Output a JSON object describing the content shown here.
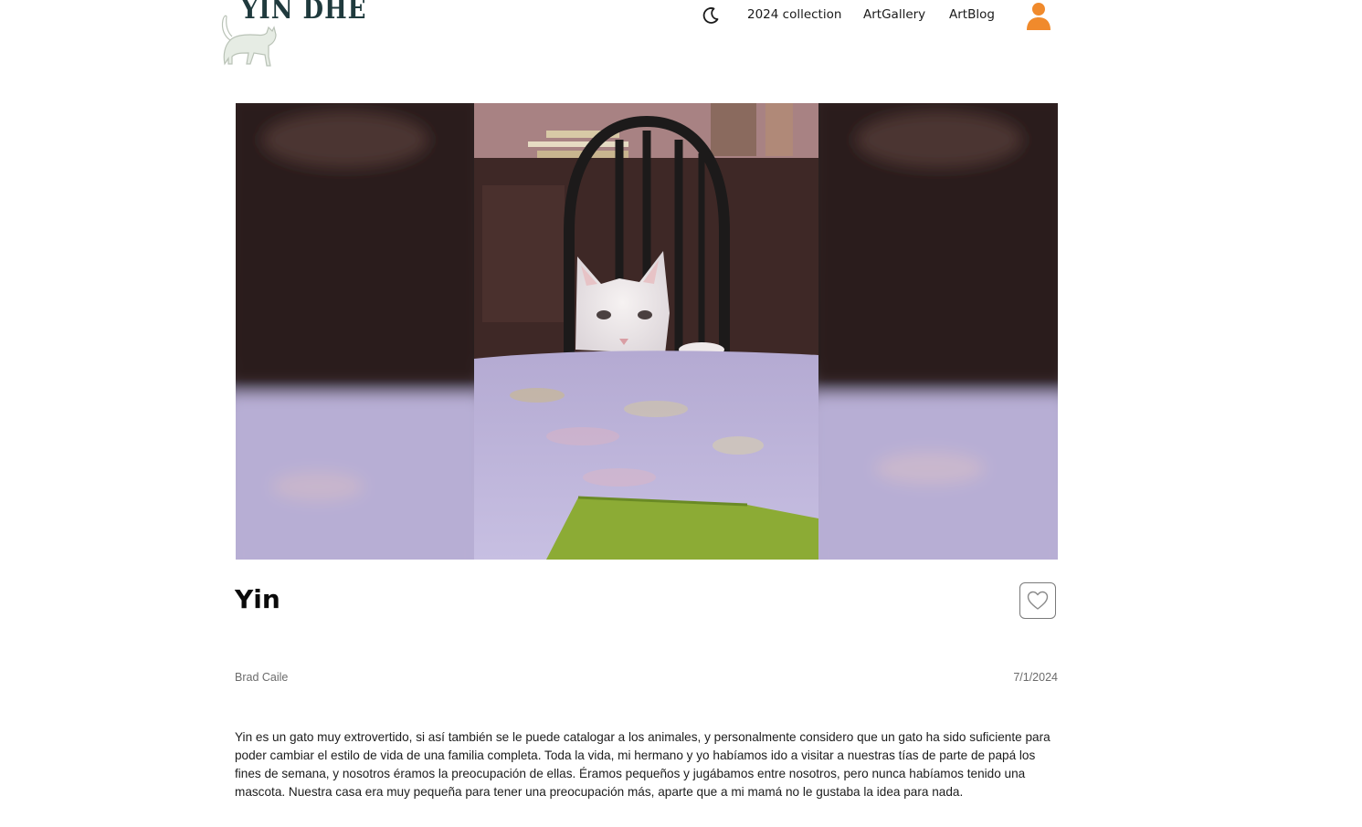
{
  "header": {
    "logo_text": "YIN DHE",
    "nav": {
      "collection_label": "2024 collection",
      "gallery_label": "ArtGallery",
      "blog_label": "ArtBlog"
    },
    "icons": {
      "theme": "moon-icon",
      "account": "user-icon"
    },
    "accent_color": "#f08a2c"
  },
  "post": {
    "title": "Yin",
    "author": "Brad Caile",
    "date": "7/1/2024",
    "body": "Yin es un gato muy extrovertido, si así también se le puede catalogar a los animales, y personalmente considero que un gato ha sido suficiente para poder cambiar el estilo de vida de una familia completa. Toda la vida, mi hermano y yo habíamos ido a visitar a nuestras tías de parte de papá los fines de semana, y nosotros éramos la preocupación de ellas. Éramos pequeños y jugábamos entre nosotros, pero nunca habíamos tenido una mascota. Nuestra casa era muy pequeña para tener una preocupación más, aparte que a mi mamá no le gustaba la idea para nada.",
    "like_icon": "heart-icon"
  }
}
